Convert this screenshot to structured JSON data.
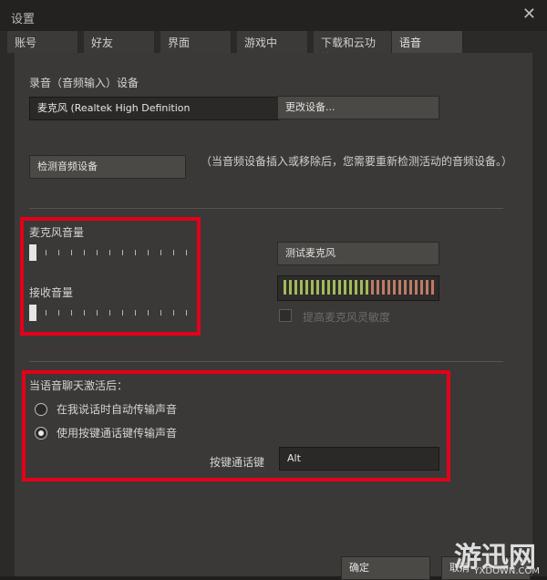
{
  "window": {
    "title": "设置",
    "close_glyph": "✕"
  },
  "tabs": [
    {
      "label": "账号"
    },
    {
      "label": "好友"
    },
    {
      "label": "界面"
    },
    {
      "label": "游戏中"
    },
    {
      "label": "下载和云功能"
    },
    {
      "label": "语音"
    }
  ],
  "recording": {
    "label": "录音（音频输入）设备",
    "device_value": "麦克风 (Realtek High Definition",
    "change_button": "更改设备...",
    "detect_button": "检测音频设备",
    "detect_note": "（当音频设备插入或移除后，您需要重新检测活动的音频设备。）"
  },
  "mic": {
    "volume_label": "麦克风音量",
    "volume_level": 0,
    "receive_label": "接收音量",
    "receive_level": 0,
    "test_button": "测试麦克风",
    "boost_label": "提高麦克风灵敏度"
  },
  "voice": {
    "activation_label": "当语音聊天激活后：",
    "option_auto": "在我说话时自动传输声音",
    "option_push": "使用按键通话键传输声音",
    "push_key_label": "按键通话键",
    "push_key_value": "Alt"
  },
  "footer": {
    "ok_button": "确定",
    "cancel_button": "取消"
  },
  "watermark": {
    "text": "游迅网",
    "sub": "YXDOWN.COM"
  },
  "colors": {
    "highlight_box": "#e3001a",
    "meter_active": "#a1b95a",
    "meter_idle": "#bd7b68"
  }
}
